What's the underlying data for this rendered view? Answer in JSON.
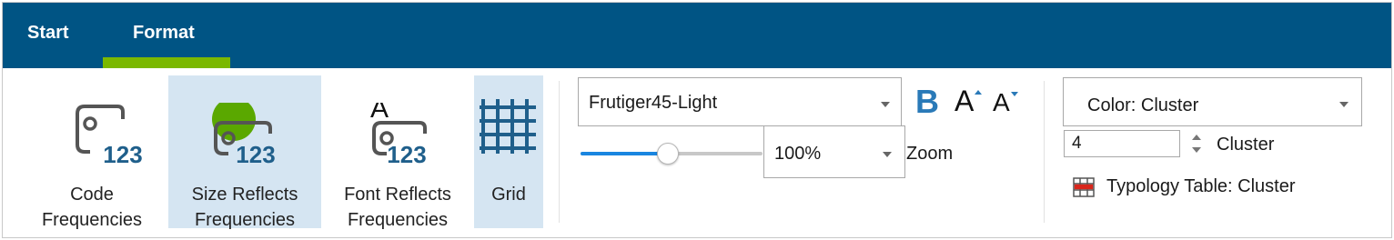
{
  "tabs": [
    {
      "label": "Start",
      "active": false
    },
    {
      "label": "Format",
      "active": true
    }
  ],
  "accent_colors": {
    "header": "#005484",
    "tab_underline": "#7ab800",
    "selected_bg": "#d5e5f2",
    "icon_blue": "#1f5f8b",
    "bubble_green": "#5aa800"
  },
  "buttons": {
    "code_frequencies": {
      "line1": "Code",
      "line2": "Frequencies",
      "icon": "code-tag-icon",
      "selected": false
    },
    "size_reflects": {
      "line1": "Size Reflects",
      "line2": "Frequencies",
      "icon": "size-tag-icon",
      "selected": true
    },
    "font_reflects": {
      "line1": "Font Reflects",
      "line2": "Frequencies",
      "icon": "font-tag-icon",
      "selected": false
    },
    "grid": {
      "label": "Grid",
      "icon": "grid-icon",
      "selected": true
    }
  },
  "icon_text": {
    "digits": "123",
    "font_letter": "A"
  },
  "font": {
    "family_value": "Frutiger45-Light",
    "bold_label": "B",
    "grow_label": "A",
    "shrink_label": "A"
  },
  "zoom": {
    "value": "100%",
    "label": "Zoom",
    "slider_fraction": 0.48
  },
  "color": {
    "value": "Color: Cluster"
  },
  "cluster": {
    "count": "4",
    "label": "Cluster"
  },
  "typology": {
    "label": "Typology Table: Cluster",
    "icon": "table-icon"
  }
}
